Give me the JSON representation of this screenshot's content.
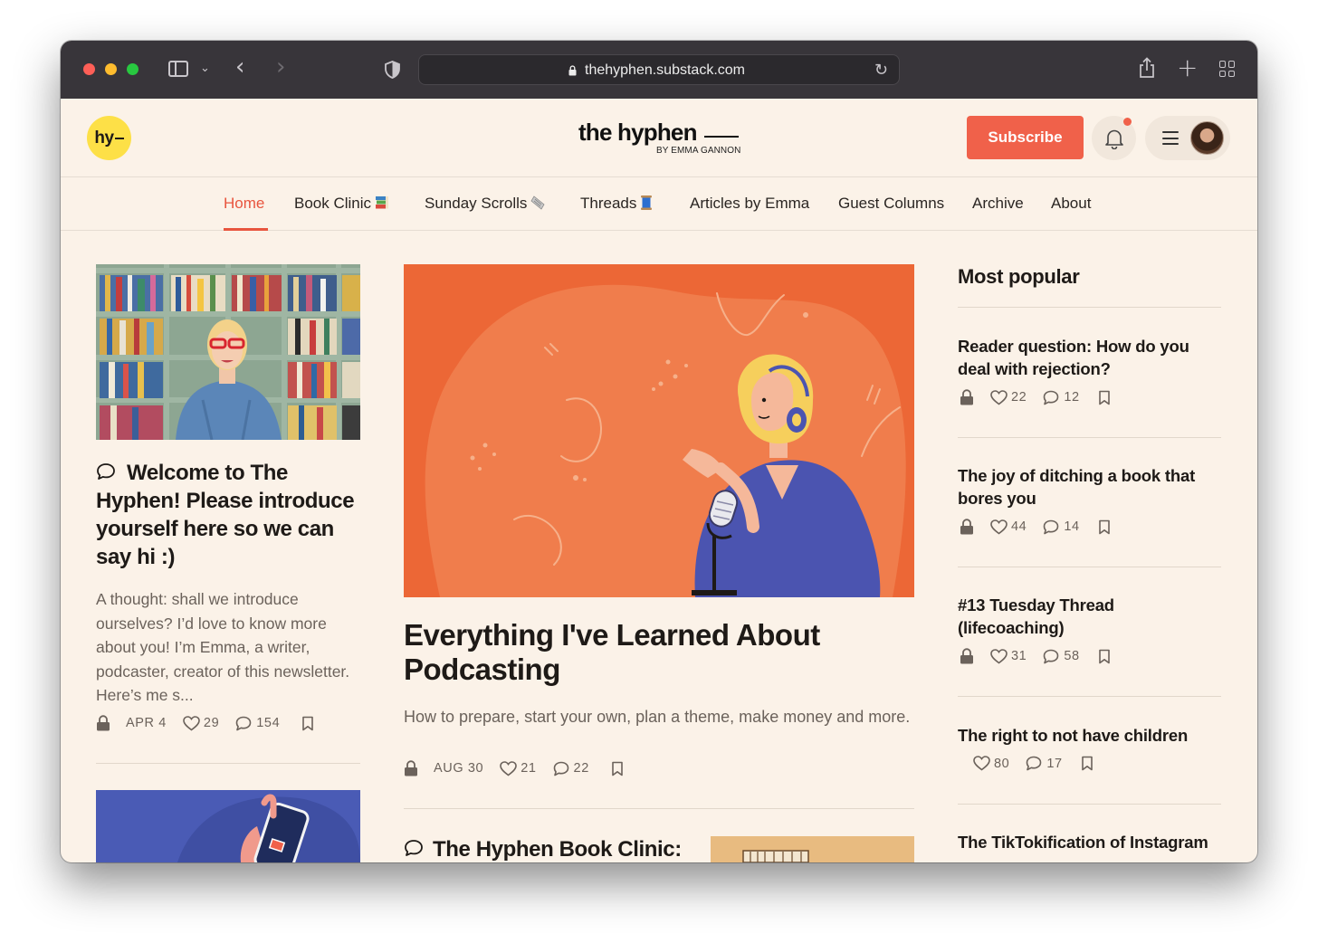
{
  "browser": {
    "url": "thehyphen.substack.com"
  },
  "site": {
    "logo_text": "hy",
    "masthead_title": "the hyphen",
    "masthead_byline": "BY EMMA GANNON",
    "subscribe_label": "Subscribe",
    "accent_color": "#f0614a",
    "badge_color": "#fde047"
  },
  "nav": {
    "items": [
      {
        "label": "Home",
        "icon": null
      },
      {
        "label": "Book Clinic",
        "icon": "books-emoji"
      },
      {
        "label": "Sunday Scrolls",
        "icon": "newspaper-emoji"
      },
      {
        "label": "Threads",
        "icon": "thread-spool-emoji"
      },
      {
        "label": "Articles by Emma",
        "icon": null
      },
      {
        "label": "Guest Columns",
        "icon": null
      },
      {
        "label": "Archive",
        "icon": null
      },
      {
        "label": "About",
        "icon": null
      }
    ],
    "active_index": 0
  },
  "left_post": {
    "title": "Welcome to The Hyphen! Please introduce yourself here so we can say hi :)",
    "excerpt": "A thought: shall we introduce ourselves? I’d love to know more about you! I’m Emma, a writer, podcaster, creator of this newsletter. Here’s me s...",
    "date": "APR 4",
    "likes": "29",
    "comments": "154"
  },
  "featured_post": {
    "title": "Everything I've Learned About Podcasting",
    "subtitle": "How to prepare, start your own, plan a theme, make money and more.",
    "date": "AUG 30",
    "likes": "21",
    "comments": "22"
  },
  "next_post": {
    "title": "The Hyphen Book Clinic:"
  },
  "popular": {
    "heading": "Most popular",
    "items": [
      {
        "title": "Reader question: How do you deal with rejection?",
        "likes": "22",
        "comments": "12",
        "locked": true
      },
      {
        "title": "The joy of ditching a book that bores you",
        "likes": "44",
        "comments": "14",
        "locked": true
      },
      {
        "title": "#13 Tuesday Thread (lifecoaching)",
        "likes": "31",
        "comments": "58",
        "locked": true
      },
      {
        "title": "The right to not have children",
        "likes": "80",
        "comments": "17",
        "locked": false
      },
      {
        "title": "The TikTokification of Instagram",
        "likes": "",
        "comments": "",
        "locked": false
      }
    ]
  }
}
